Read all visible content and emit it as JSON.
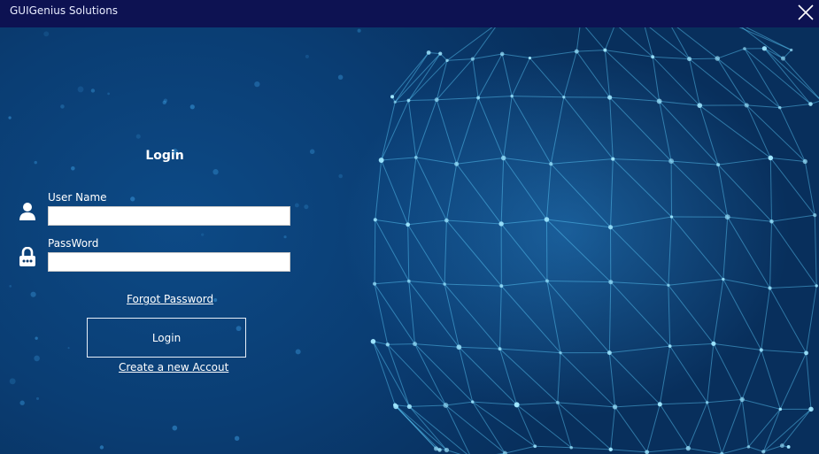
{
  "window": {
    "title": "GUIGenius Solutions"
  },
  "login": {
    "heading": "Login",
    "username": {
      "label": "User Name",
      "value": "",
      "placeholder": ""
    },
    "password": {
      "label": "PassWord",
      "value": "",
      "placeholder": ""
    },
    "forgot_link": "Forgot Password",
    "button_label": "Login",
    "create_link": "Create a new Accout"
  },
  "icons": {
    "close": "close-icon",
    "user": "user-icon",
    "lock": "lock-icon"
  },
  "colors": {
    "titlebar": "#0d1252",
    "background": "#0b3a6b",
    "network": "#5fd0ff",
    "text": "#ffffff"
  }
}
